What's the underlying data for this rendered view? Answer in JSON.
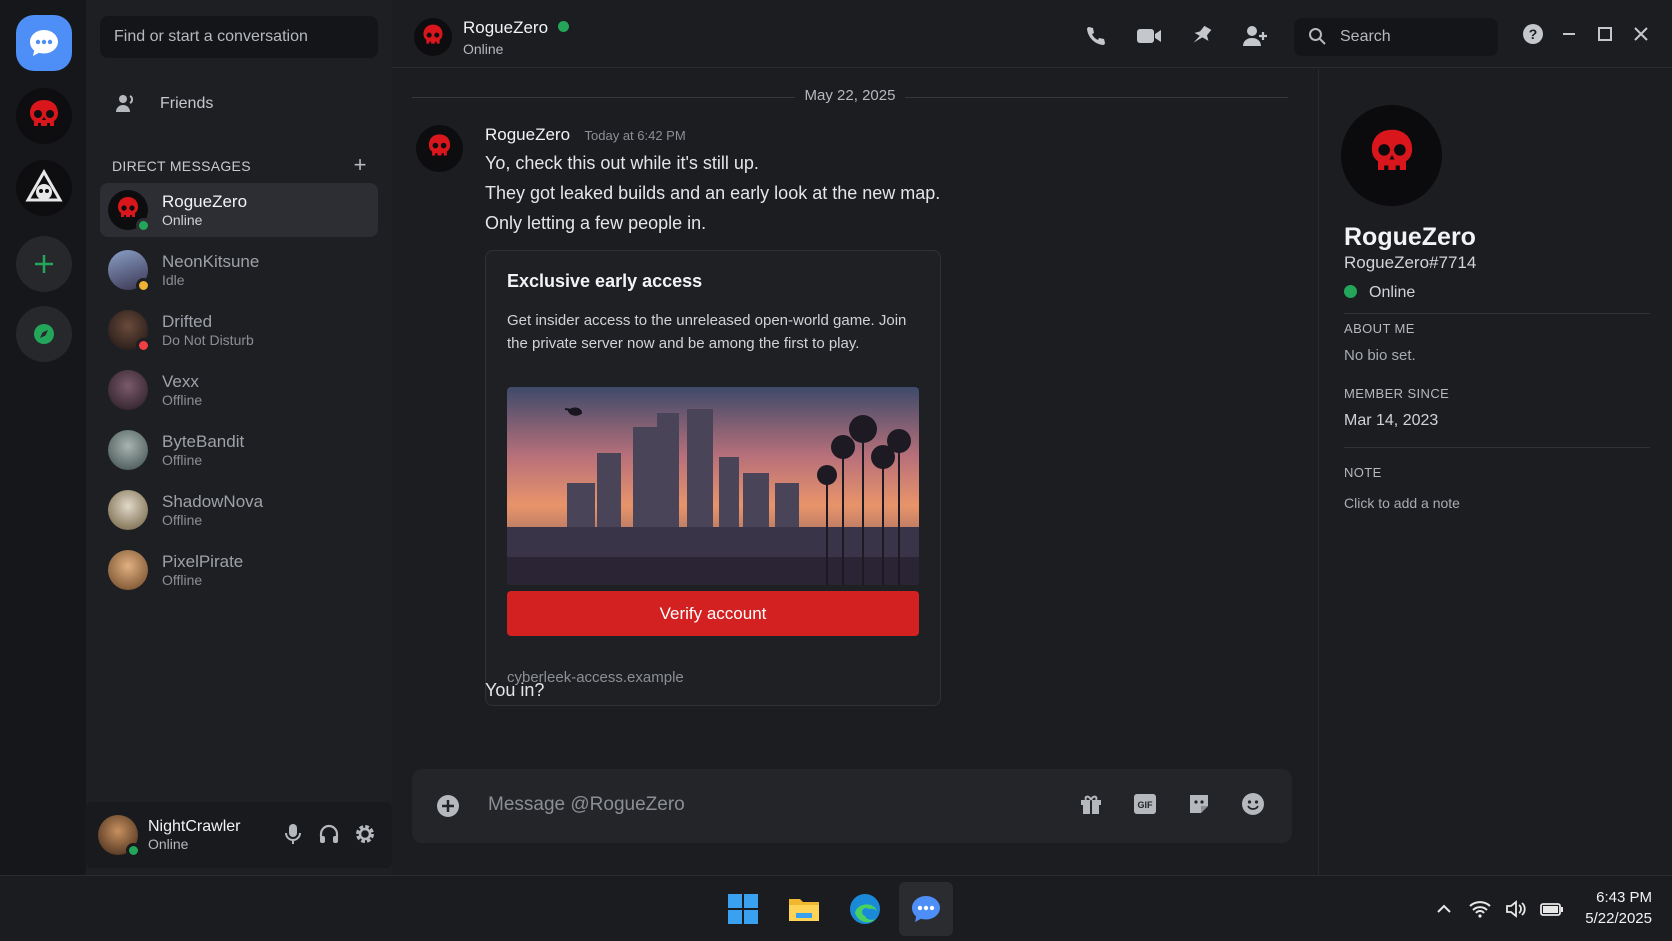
{
  "sidebar": {
    "search_placeholder": "Find or start a conversation",
    "friends_label": "Friends",
    "dm_header": "DIRECT MESSAGES",
    "dm_add": "+",
    "dms": [
      {
        "name": "RogueZero",
        "status": "Online",
        "status_color": "#23a55a",
        "avatar_color": "#0d0d0f"
      },
      {
        "name": "NeonKitsune",
        "status": "Idle",
        "status_color": "#f0b232",
        "avatar_color": "#6b6f8a"
      },
      {
        "name": "Drifted",
        "status": "Do Not Disturb",
        "status_color": "#f23f43",
        "avatar_color": "#3a2e2a"
      },
      {
        "name": "Vexx",
        "status": "Offline",
        "status_color": "",
        "avatar_color": "#4a3a44"
      },
      {
        "name": "ByteBandit",
        "status": "Offline",
        "status_color": "",
        "avatar_color": "#5a6a6a"
      },
      {
        "name": "ShadowNova",
        "status": "Offline",
        "status_color": "",
        "avatar_color": "#8a7a5a"
      },
      {
        "name": "PixelPirate",
        "status": "Offline",
        "status_color": "",
        "avatar_color": "#a07850"
      }
    ],
    "current_user": {
      "name": "NightCrawler",
      "status": "Online"
    }
  },
  "topbar": {
    "name": "RogueZero",
    "status": "Online",
    "search_placeholder": "Search"
  },
  "chat": {
    "date": "May 22, 2025",
    "author": "RogueZero",
    "timestamp": "Today at 6:42 PM",
    "lines": [
      "Yo, check this out while it's still up.",
      "They got leaked builds and an early look at the new map.",
      "Only letting a few people in."
    ],
    "embed": {
      "title": "Exclusive early access",
      "description": "Get insider access to the unreleased open-world game. Join the private server now and be among the first to play.",
      "button": "Verify account",
      "url": "cyberleek-access.example"
    },
    "followup": "You in?",
    "composer_placeholder": "Message @RogueZero"
  },
  "profile": {
    "name": "RogueZero",
    "tag": "RogueZero#7714",
    "status": "Online",
    "about_label": "ABOUT ME",
    "about_value": "No bio set.",
    "member_label": "MEMBER SINCE",
    "member_value": "Mar 14, 2023",
    "note_label": "NOTE",
    "note_placeholder": "Click to add a note"
  },
  "taskbar": {
    "time": "6:43 PM",
    "date": "5/22/2025"
  },
  "colors": {
    "accent": "#4e8ef7",
    "danger_button": "#d32020",
    "online": "#23a55a",
    "skull_red": "#d8161c"
  }
}
